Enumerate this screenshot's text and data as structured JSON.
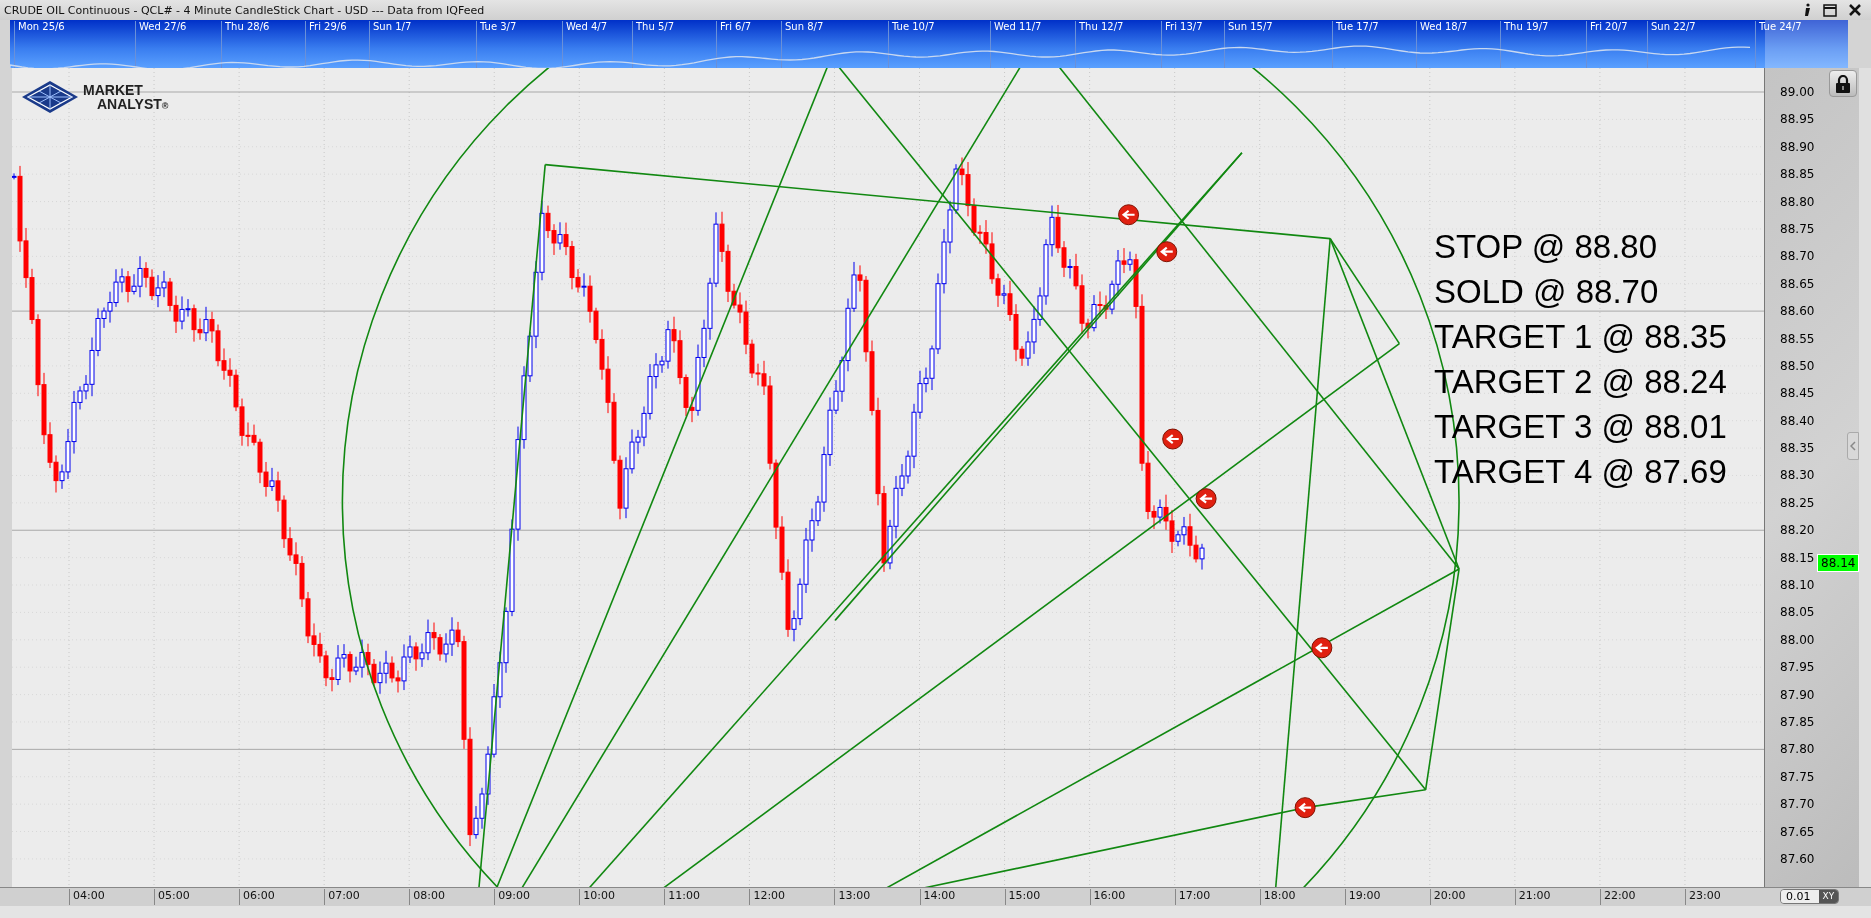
{
  "window": {
    "title": "CRUDE OIL Continuous - QCL# - 4 Minute CandleStick Chart - USD --- Data from IQFeed"
  },
  "navigator": {
    "dates": [
      "Mon 25/6",
      "Wed 27/6",
      "Thu 28/6",
      "Fri 29/6",
      "Sun 1/7",
      "Tue 3/7",
      "Wed 4/7",
      "Thu 5/7",
      "Fri 6/7",
      "Sun 8/7",
      "Tue 10/7",
      "Wed 11/7",
      "Thu 12/7",
      "Fri 13/7",
      "Sun 15/7",
      "Tue 17/7",
      "Wed 18/7",
      "Thu 19/7",
      "Fri 20/7",
      "Sun 22/7",
      "Tue 24/7"
    ]
  },
  "logo": {
    "line1": "MARKET",
    "line2": "ANALYST",
    "mark": "®"
  },
  "annotations": [
    "STOP @ 88.80",
    "SOLD @ 88.70",
    "TARGET 1 @ 88.35",
    "TARGET 2 @ 88.24",
    "TARGET 3 @ 88.01",
    "TARGET 4 @ 87.69"
  ],
  "price_axis": {
    "labels": [
      "89.00",
      "88.95",
      "88.90",
      "88.85",
      "88.80",
      "88.75",
      "88.70",
      "88.65",
      "88.60",
      "88.55",
      "88.50",
      "88.45",
      "88.40",
      "88.35",
      "88.30",
      "88.25",
      "88.20",
      "88.15",
      "88.10",
      "88.05",
      "88.00",
      "87.95",
      "87.90",
      "87.85",
      "87.80",
      "87.75",
      "87.70",
      "87.65",
      "87.60"
    ],
    "current_price": "88.14"
  },
  "time_axis": {
    "labels": [
      "04:00",
      "05:00",
      "06:00",
      "07:00",
      "08:00",
      "09:00",
      "10:00",
      "11:00",
      "12:00",
      "13:00",
      "14:00",
      "15:00",
      "16:00",
      "17:00",
      "18:00",
      "19:00",
      "20:00",
      "21:00",
      "22:00",
      "23:00"
    ]
  },
  "zoom_field": {
    "value": "0.01",
    "lock_label": "XY"
  }
}
